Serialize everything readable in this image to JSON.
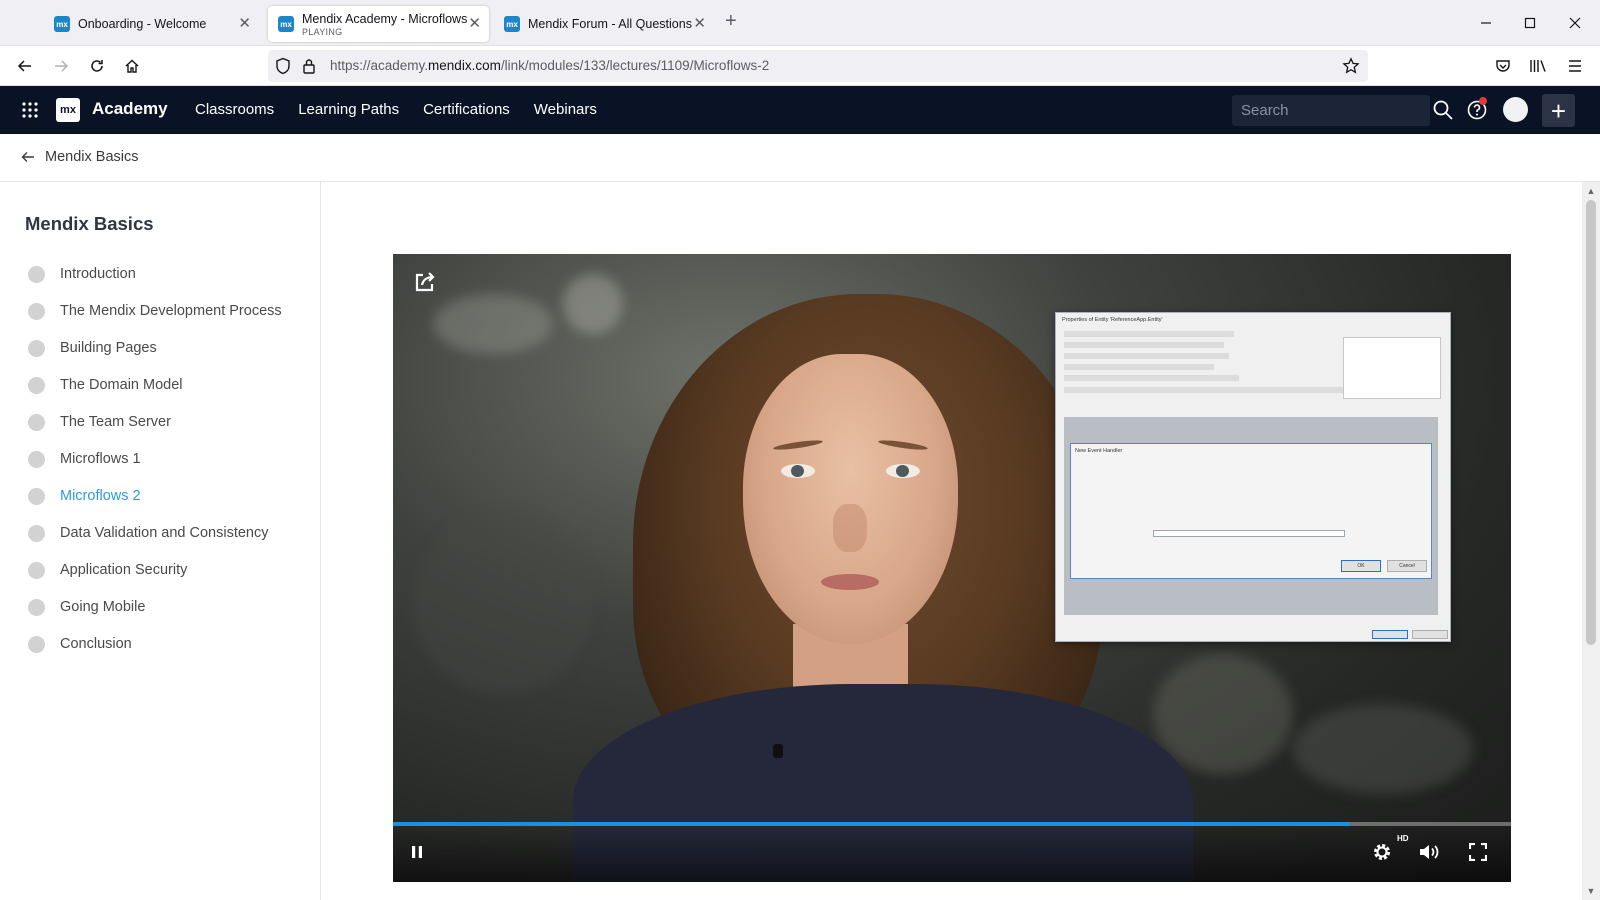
{
  "browser": {
    "tabs": [
      {
        "title": "Onboarding - Welcome",
        "subtitle": "",
        "favicon": "mx",
        "active": false
      },
      {
        "title": "Mendix Academy - Microflows",
        "subtitle": "PLAYING",
        "favicon": "mx",
        "active": true
      },
      {
        "title": "Mendix Forum - All Questions",
        "subtitle": "",
        "favicon": "mx",
        "active": false
      }
    ],
    "url": {
      "prefix": "https://academy.",
      "domain": "mendix.com",
      "path": "/link/modules/133/lectures/1109/Microflows-2"
    }
  },
  "header": {
    "logo_text": "mx",
    "brand": "Academy",
    "nav": [
      "Classrooms",
      "Learning Paths",
      "Certifications",
      "Webinars"
    ],
    "search_placeholder": "Search",
    "colors": {
      "background": "#0a1325",
      "notification": "#e53935"
    }
  },
  "breadcrumb": {
    "label": "Mendix Basics"
  },
  "sidebar": {
    "title": "Mendix Basics",
    "lessons": [
      "Introduction",
      "The Mendix Development Process",
      "Building Pages",
      "The Domain Model",
      "The Team Server",
      "Microflows 1",
      "Microflows 2",
      "Data Validation and Consistency",
      "Application Security",
      "Going Mobile",
      "Conclusion"
    ],
    "current": "Microflows 2",
    "current_color": "#2e9ae6"
  },
  "video": {
    "state": "playing",
    "progress": 0.856,
    "quality_badge": "HD",
    "progress_color": "#1b8fe0",
    "overlay_window": {
      "title": "Properties of Entity 'ReferenceApp.Entity'",
      "dialog_title": "New Event Handler",
      "ok": "OK",
      "cancel": "Cancel"
    }
  }
}
